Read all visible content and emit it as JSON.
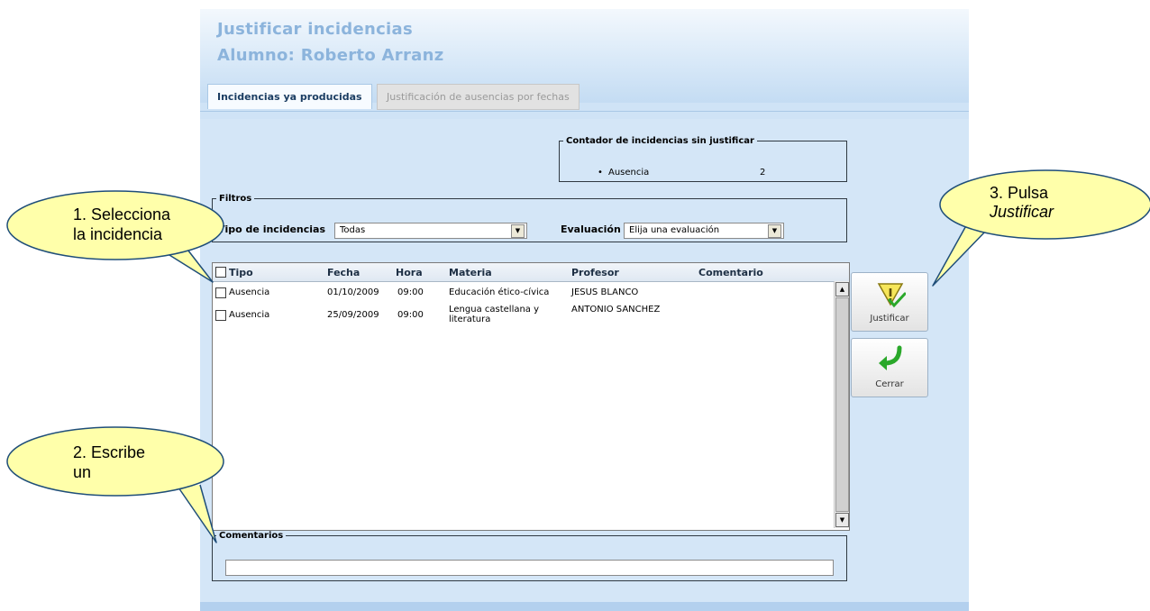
{
  "window": {
    "title": "Justificar incidencias",
    "subtitle": "Alumno: Roberto Arranz"
  },
  "tabs": [
    {
      "label": "Incidencias ya producidas",
      "active": true
    },
    {
      "label": "Justificación de ausencias por fechas",
      "active": false
    }
  ],
  "counter": {
    "legend": "Contador de incidencias sin justificar",
    "bullet": "•",
    "item": "Ausencia",
    "count": "2"
  },
  "filters": {
    "legend": "Filtros",
    "type_label": "Tipo de incidencias",
    "type_value": "Todas",
    "eval_label": "Evaluación",
    "eval_value": "Elija una evaluación"
  },
  "table": {
    "headers": [
      "Tipo",
      "Fecha",
      "Hora",
      "Materia",
      "Profesor",
      "Comentario"
    ],
    "rows": [
      {
        "tipo": "Ausencia",
        "fecha": "01/10/2009",
        "hora": "09:00",
        "materia1": "Educación ético-cívica",
        "materia2": "",
        "profesor": "JESUS BLANCO",
        "comentario": ""
      },
      {
        "tipo": "Ausencia",
        "fecha": "25/09/2009",
        "hora": "09:00",
        "materia1": "Lengua castellana y",
        "materia2": "literatura",
        "profesor": "ANTONIO SANCHEZ",
        "comentario": ""
      }
    ]
  },
  "comments": {
    "legend": "Comentarios",
    "value": ""
  },
  "actions": {
    "justify_label": "Justificar",
    "close_label": "Cerrar"
  },
  "callouts": {
    "c1_line1": "1. Selecciona",
    "c1_line2": "la incidencia",
    "c2_line1": "2. Escribe",
    "c2_line2": "un",
    "c3_line1": "3. Pulsa",
    "c3_line2": "Justificar"
  },
  "colors": {
    "title": "#8cb4dc",
    "background": "#d4e6f7",
    "callout_fill": "#ffffaa",
    "callout_stroke": "#1f4e79",
    "check_arrow": "#2aa82a"
  }
}
